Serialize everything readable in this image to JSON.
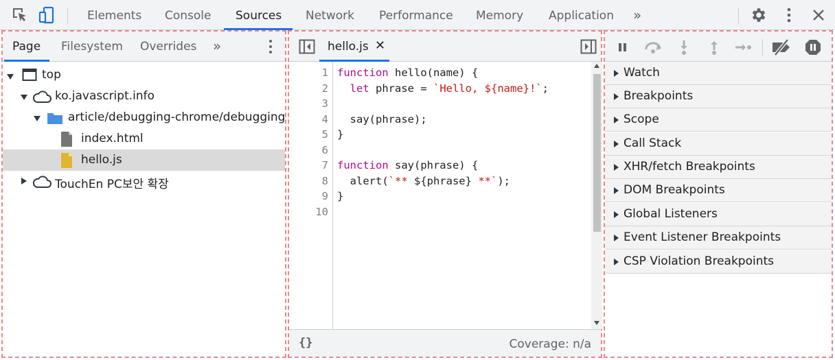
{
  "toolbar": {
    "icons": [
      "inspect-element-icon",
      "device-toolbar-icon",
      "settings-icon",
      "more-vert-icon",
      "close-icon"
    ],
    "tabs": [
      "Elements",
      "Console",
      "Sources",
      "Network",
      "Performance",
      "Memory",
      "Application"
    ],
    "active_tab": "Sources",
    "more_tabs": "»"
  },
  "navigator": {
    "tabs": [
      "Page",
      "Filesystem",
      "Overrides"
    ],
    "active_tab": "Page",
    "more_tabs": "»",
    "tree": [
      {
        "label": "top",
        "icon": "frame-icon",
        "expanded": true
      },
      {
        "label": "ko.javascript.info",
        "icon": "cloud-icon",
        "expanded": true
      },
      {
        "label": "article/debugging-chrome/debugging",
        "icon": "folder-icon",
        "expanded": true
      },
      {
        "label": "index.html",
        "icon": "file-icon"
      },
      {
        "label": "hello.js",
        "icon": "js-file-icon",
        "selected": true
      },
      {
        "label": "TouchEn PC보안 확장",
        "icon": "cloud-icon",
        "expanded": false
      }
    ]
  },
  "editor": {
    "file_tab": "hello.js",
    "close_glyph": "✕",
    "line_numbers": [
      "1",
      "2",
      "3",
      "4",
      "5",
      "6",
      "7",
      "8",
      "9",
      "10"
    ],
    "code": {
      "l1_kw": "function",
      "l1_rest": " hello(name) {",
      "l2_pre": "  ",
      "l2_kw": "let",
      "l2_mid": " phrase = ",
      "l2_str": "`Hello, ${name}!`",
      "l2_end": ";",
      "l4": "  say(phrase);",
      "l5": "}",
      "l7_kw": "function",
      "l7_rest": " say(phrase) {",
      "l8_pre": "  alert(",
      "l8_s1": "`** ",
      "l8_mid": "${phrase}",
      "l8_s2": " **`",
      "l8_end": ");",
      "l9": "}"
    },
    "format_button": "{}",
    "coverage": "Coverage: n/a"
  },
  "debugger": {
    "icons": [
      "pause-icon",
      "step-over-icon",
      "step-into-icon",
      "step-out-icon",
      "step-icon",
      "deactivate-breakpoints-icon",
      "pause-on-exceptions-icon"
    ],
    "sections": [
      "Watch",
      "Breakpoints",
      "Scope",
      "Call Stack",
      "XHR/fetch Breakpoints",
      "DOM Breakpoints",
      "Global Listeners",
      "Event Listener Breakpoints",
      "CSP Violation Breakpoints"
    ]
  },
  "colors": {
    "accent": "#1a73e8",
    "keyword": "#aa0d91",
    "string": "#c41a16",
    "js_file": "#e2b52f",
    "folder": "#4a90e2"
  }
}
